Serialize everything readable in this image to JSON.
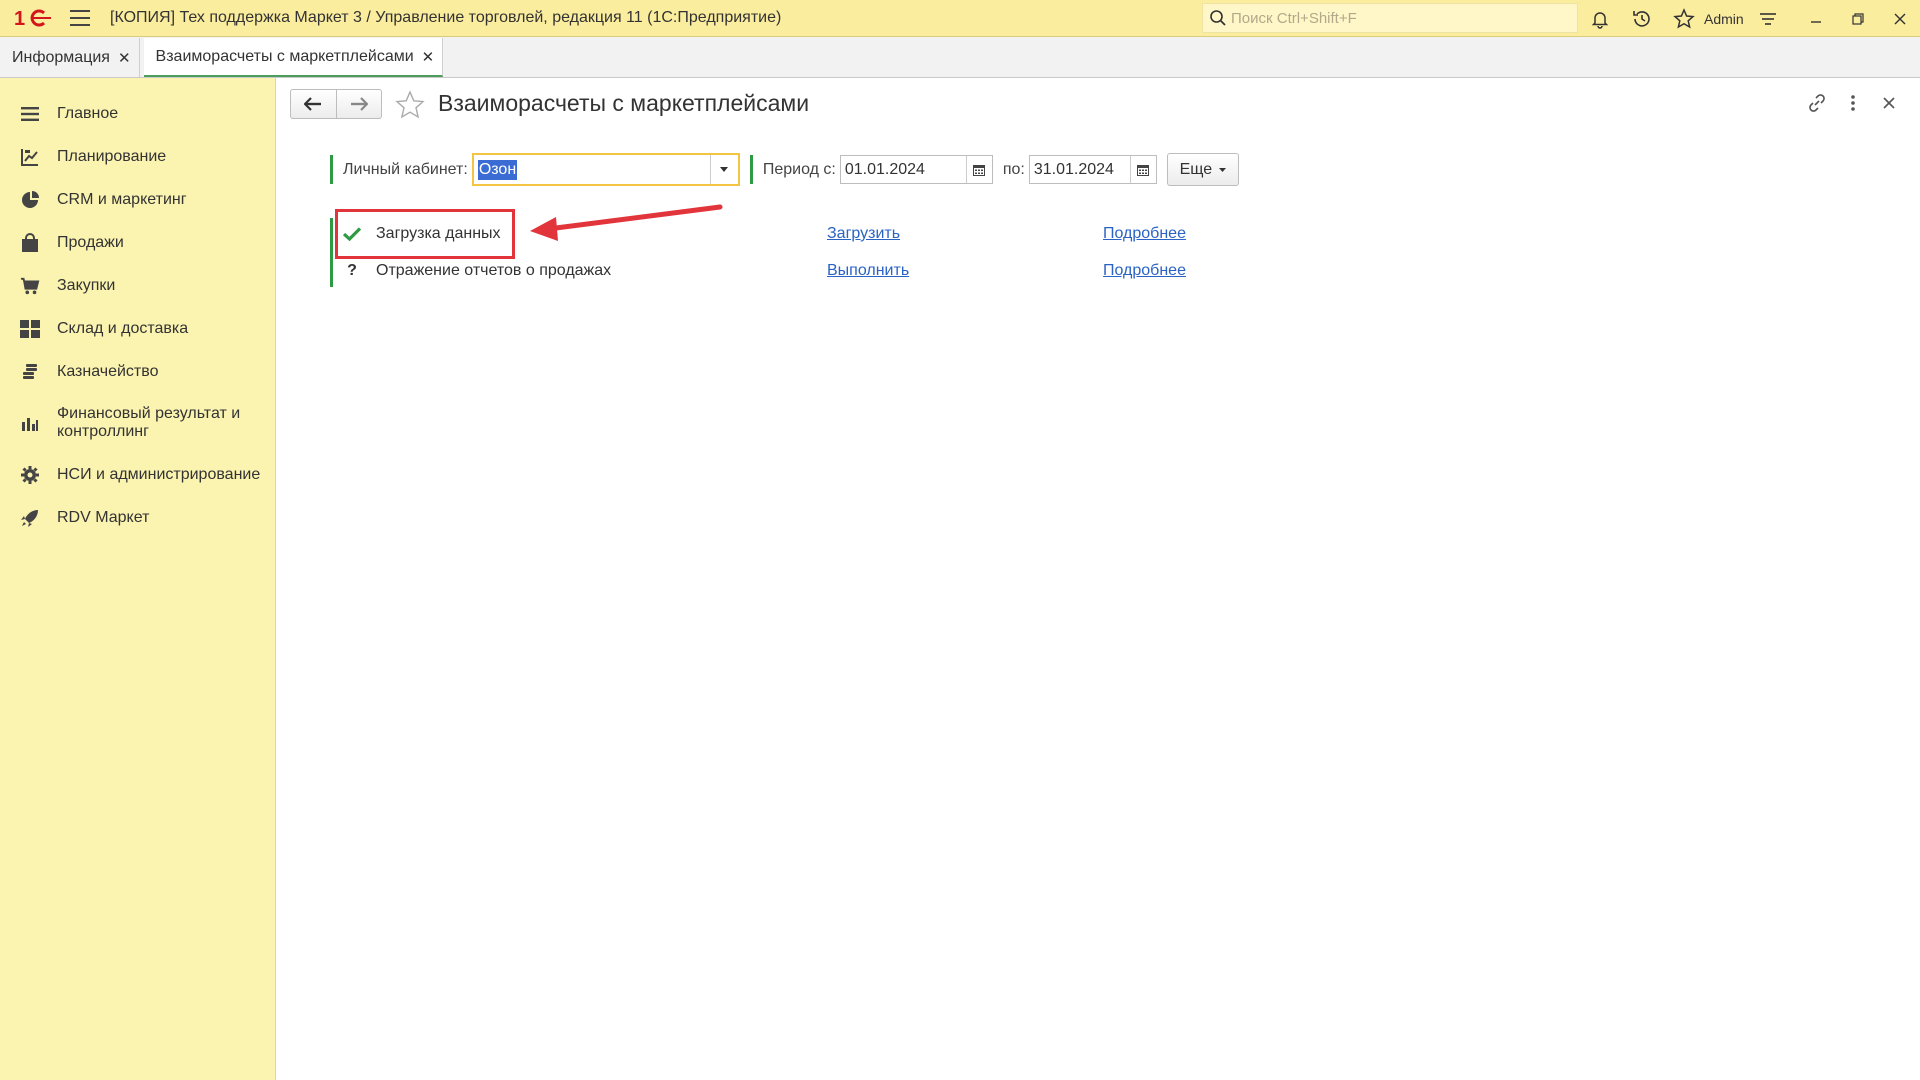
{
  "titlebar": {
    "title": "[КОПИЯ] Тех поддержка Маркет 3 / Управление торговлей, редакция 11  (1С:Предприятие)",
    "search_placeholder": "Поиск Ctrl+Shift+F",
    "user": "Admin"
  },
  "tabs": [
    {
      "label": "Информация",
      "active": false
    },
    {
      "label": "Взаиморасчеты с маркетплейсами",
      "active": true
    }
  ],
  "sidebar": {
    "items": [
      {
        "label": "Главное",
        "icon": "menu-icon"
      },
      {
        "label": "Планирование",
        "icon": "planning-icon"
      },
      {
        "label": "CRM и маркетинг",
        "icon": "pie-chart-icon"
      },
      {
        "label": "Продажи",
        "icon": "shopping-bag-icon"
      },
      {
        "label": "Закупки",
        "icon": "cart-icon"
      },
      {
        "label": "Склад и доставка",
        "icon": "warehouse-icon"
      },
      {
        "label": "Казначейство",
        "icon": "coins-icon"
      },
      {
        "label": "Финансовый результат и контроллинг",
        "line1": "Финансовый результат и",
        "line2": "контроллинг",
        "icon": "bar-chart-icon"
      },
      {
        "label": "НСИ и администрирование",
        "icon": "gear-icon"
      },
      {
        "label": "RDV Маркет",
        "icon": "rocket-icon"
      }
    ]
  },
  "page": {
    "title": "Взаиморасчеты с маркетплейсами"
  },
  "filters": {
    "cabinet_label": "Личный кабинет:",
    "cabinet_value": "Озон",
    "period_from_label": "Период с:",
    "period_from": "01.01.2024",
    "period_to_label": "по:",
    "period_to": "31.01.2024",
    "more_label": "Еще"
  },
  "steps": [
    {
      "status_icon": "check-icon",
      "name": "Загрузка данных",
      "action": "Загрузить",
      "details": "Подробнее"
    },
    {
      "status_icon": "question-icon",
      "status_text": "?",
      "name": "Отражение отчетов о продажах",
      "action": "Выполнить",
      "details": "Подробнее"
    }
  ],
  "colors": {
    "titlebar_bg": "#fbed9e",
    "sidebar_bg": "#fbf3b0",
    "accent_green": "#2e9a43",
    "link_blue": "#2a63c4",
    "annotation_red": "#e2343b"
  }
}
